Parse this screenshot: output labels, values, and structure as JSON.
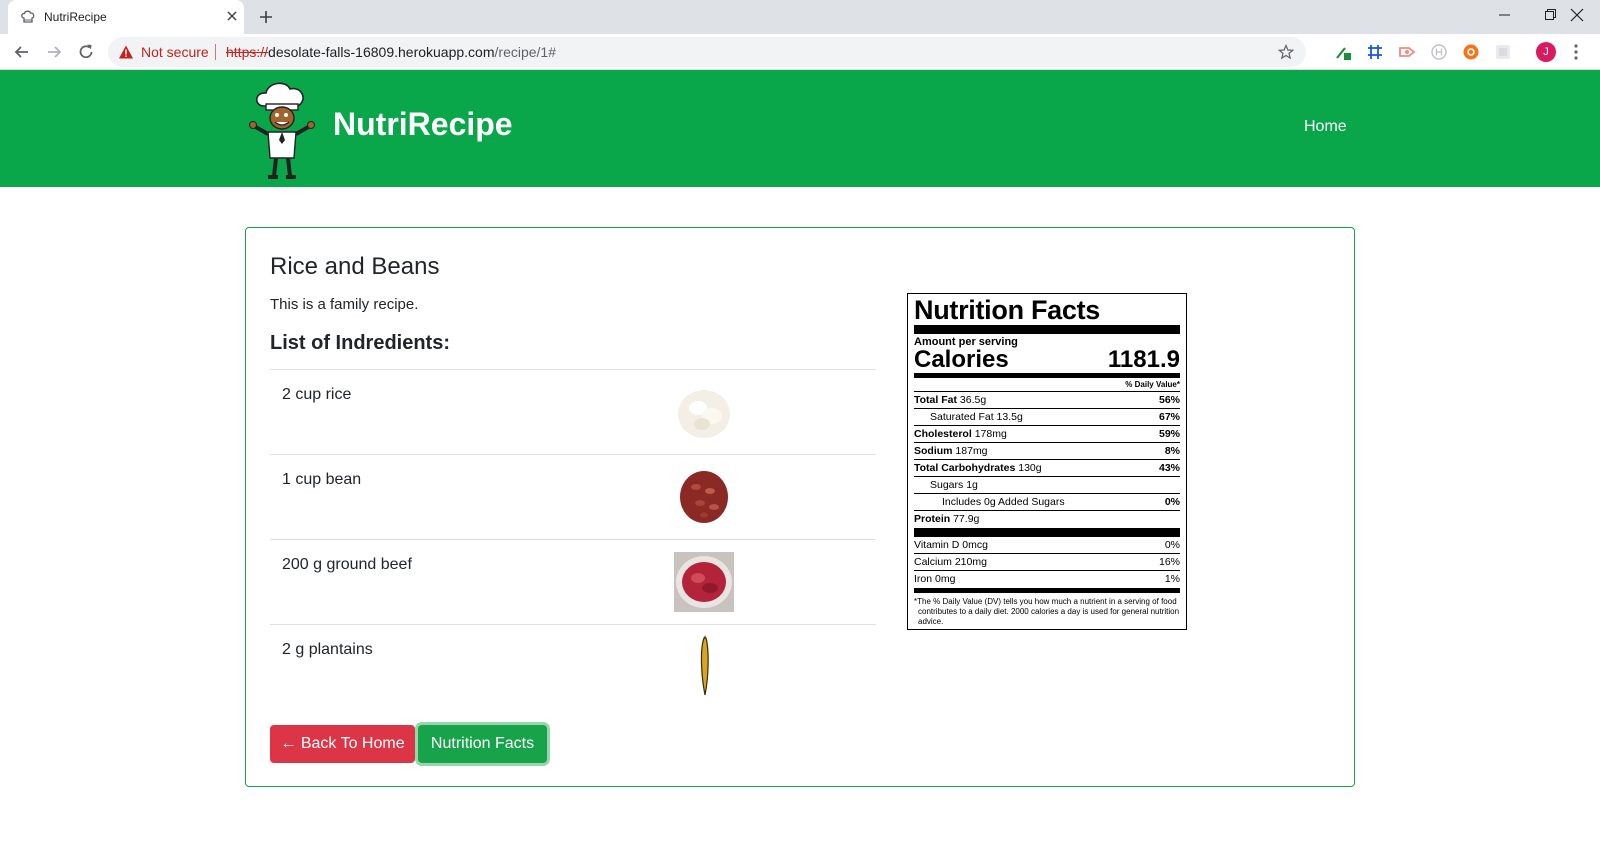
{
  "browser": {
    "tab_title": "NutriRecipe",
    "security_label": "Not secure",
    "url_scheme": "https://",
    "url_host": "desolate-falls-16809.herokuapp.com",
    "url_path": "/recipe/1#",
    "avatar_initial": "J"
  },
  "navbar": {
    "brand": "NutriRecipe",
    "home_link": "Home"
  },
  "recipe": {
    "title": "Rice and Beans",
    "description": "This is a family recipe.",
    "ingredients_heading": "List of Indredients:",
    "ingredients": [
      {
        "text": "2 cup rice",
        "image": "rice"
      },
      {
        "text": "1 cup bean",
        "image": "bean"
      },
      {
        "text": "200 g ground beef",
        "image": "ground-beef"
      },
      {
        "text": "2 g plantains",
        "image": "plantain"
      }
    ],
    "back_button": "← Back To Home",
    "nutrition_button": "Nutrition Facts"
  },
  "nutrition": {
    "title": "Nutrition Facts",
    "amount_per_serving": "Amount per serving",
    "calories_label": "Calories",
    "calories_value": "1181.9",
    "dv_header": "% Daily Value*",
    "rows": [
      {
        "label": "Total Fat",
        "amount": "36.5g",
        "pct": "56%",
        "bold": true,
        "indent": 0
      },
      {
        "label": "Saturated Fat",
        "amount": "13.5g",
        "pct": "67%",
        "bold": false,
        "indent": 1
      },
      {
        "label": "Cholesterol",
        "amount": "178mg",
        "pct": "59%",
        "bold": true,
        "indent": 0
      },
      {
        "label": "Sodium",
        "amount": "187mg",
        "pct": "8%",
        "bold": true,
        "indent": 0
      },
      {
        "label": "Total Carbohydrates",
        "amount": "130g",
        "pct": "43%",
        "bold": true,
        "indent": 0
      },
      {
        "label": "Sugars",
        "amount": "1g",
        "pct": "",
        "bold": false,
        "indent": 1
      },
      {
        "label": "Includes 0g Added Sugars",
        "amount": "",
        "pct": "0%",
        "bold": false,
        "indent": 2
      },
      {
        "label": "Protein",
        "amount": "77.9g",
        "pct": "",
        "bold": true,
        "indent": 0
      }
    ],
    "micro_rows": [
      {
        "label": "Vitamin D 0mcg",
        "pct": "0%"
      },
      {
        "label": "Calcium 210mg",
        "pct": "16%"
      },
      {
        "label": "Iron 0mg",
        "pct": "1%"
      }
    ],
    "footnote": "*The % Daily Value (DV) tells you how much a nutrient in a serving of food contributes to a daily diet. 2000 calories a day is used for general nutrition advice."
  },
  "colors": {
    "brand_green": "#0aa64a",
    "danger_red": "#dc3545",
    "success_green": "#16a34a"
  }
}
